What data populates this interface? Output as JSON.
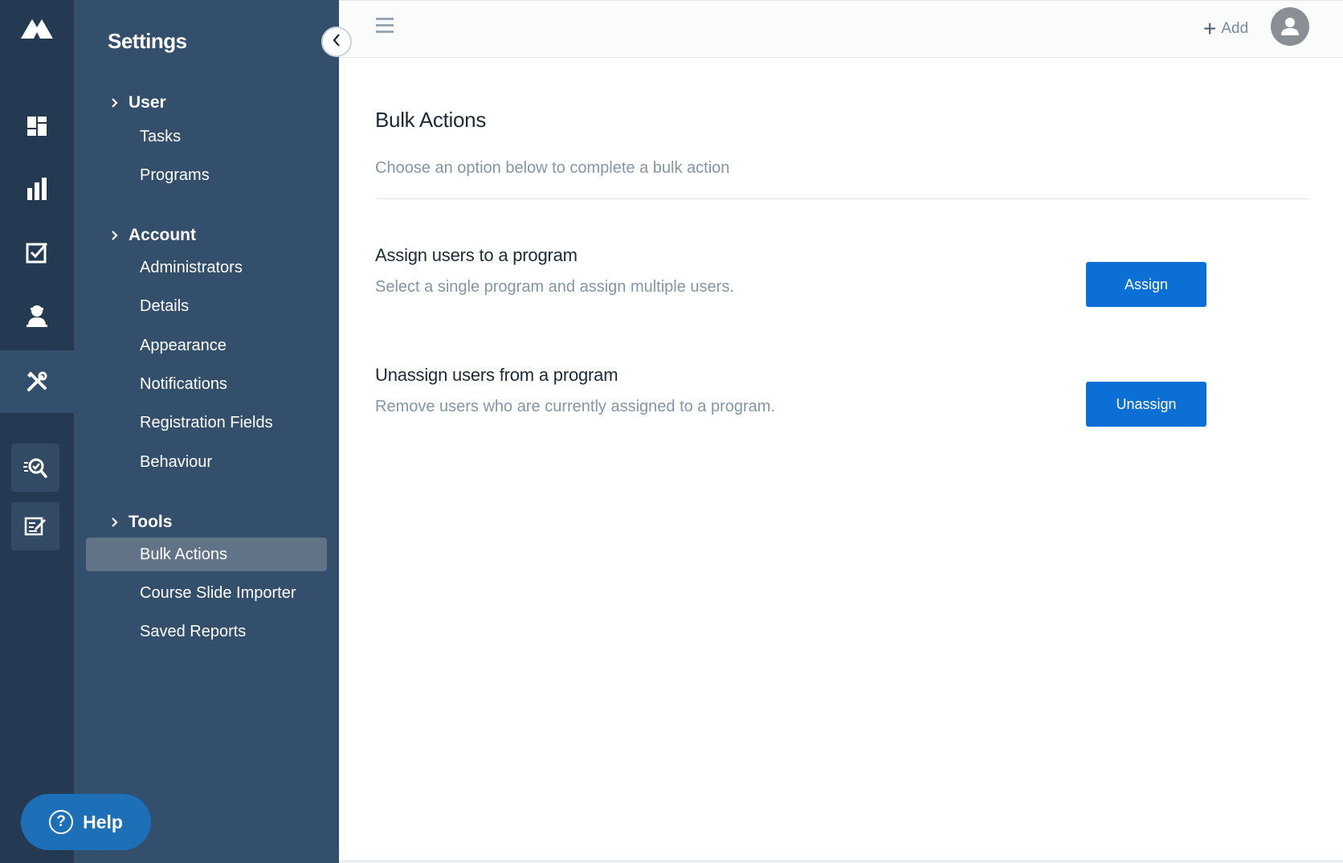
{
  "sidebar": {
    "title": "Settings",
    "groups": [
      {
        "label": "User",
        "items": [
          {
            "label": "Tasks"
          },
          {
            "label": "Programs"
          }
        ]
      },
      {
        "label": "Account",
        "items": [
          {
            "label": "Administrators"
          },
          {
            "label": "Details"
          },
          {
            "label": "Appearance"
          },
          {
            "label": "Notifications"
          },
          {
            "label": "Registration Fields"
          },
          {
            "label": "Behaviour"
          }
        ]
      },
      {
        "label": "Tools",
        "items": [
          {
            "label": "Bulk Actions",
            "active": true
          },
          {
            "label": "Course Slide Importer"
          },
          {
            "label": "Saved Reports"
          }
        ]
      }
    ],
    "help_label": "Help"
  },
  "rail": {
    "icons": [
      "logo-icon",
      "dashboard-icon",
      "reports-icon",
      "tasks-icon",
      "users-icon",
      "tools-icon",
      "search-check-icon",
      "edit-note-icon"
    ],
    "active": "tools-icon"
  },
  "topbar": {
    "add_label": "Add"
  },
  "main": {
    "title": "Bulk Actions",
    "subtitle": "Choose an option below to complete a bulk action",
    "actions": [
      {
        "title": "Assign users to a program",
        "description": "Select a single program and assign multiple users.",
        "button_label": "Assign"
      },
      {
        "title": "Unassign users from a program",
        "description": "Remove users who are currently assigned to a program.",
        "button_label": "Unassign"
      }
    ]
  },
  "colors": {
    "rail_bg": "#243a53",
    "panel_bg": "#334f6c",
    "active_item_bg": "#617487",
    "primary_button": "#0b6fd6",
    "help_button": "#1d6fb8"
  }
}
